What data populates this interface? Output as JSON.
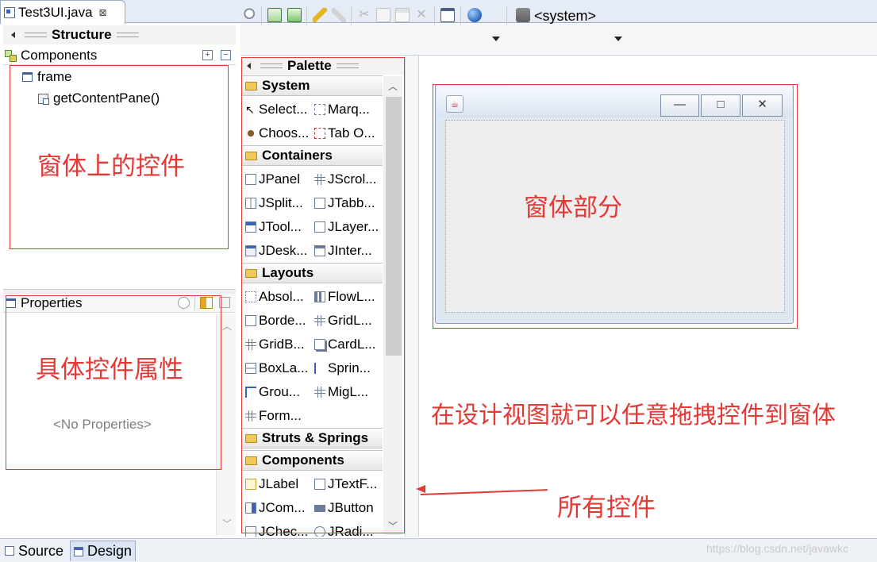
{
  "editor": {
    "tab_title": "Test3UI.java",
    "close_glyph": "⊠"
  },
  "structure": {
    "header": "Structure",
    "components_label": "Components",
    "expand_glyph": "+",
    "collapse_glyph": "−",
    "tree": [
      {
        "label": "frame"
      },
      {
        "label": "getContentPane()"
      }
    ]
  },
  "properties": {
    "header": "Properties",
    "empty_text": "<No Properties>"
  },
  "toolbar": {
    "system_label": "<system>"
  },
  "palette": {
    "header": "Palette",
    "categories": {
      "system": "System",
      "containers": "Containers",
      "layouts": "Layouts",
      "struts": "Struts & Springs",
      "components": "Components"
    },
    "items": {
      "system": [
        "Select...",
        "Marq...",
        "Choos...",
        "Tab O..."
      ],
      "containers": [
        "JPanel",
        "JScrol...",
        "JSplit...",
        "JTabb...",
        "JTool...",
        "JLayer...",
        "JDesk...",
        "JInter..."
      ],
      "layouts": [
        "Absol...",
        "FlowL...",
        "Borde...",
        "GridL...",
        "GridB...",
        "CardL...",
        "BoxLa...",
        "Sprin...",
        "Grou...",
        "MigL...",
        "Form..."
      ],
      "components": [
        "JLabel",
        "JTextF...",
        "JCom...",
        "JButton",
        "JChec...",
        "JRadi..."
      ]
    }
  },
  "frame_buttons": {
    "minimize": "—",
    "maximize": "□",
    "close": "✕"
  },
  "bottom_tabs": {
    "source": "Source",
    "design": "Design"
  },
  "watermark": "https://blog.csdn.net/javawkc",
  "annotations": {
    "controls_on_window": "窗体上的控件",
    "control_properties": "具体控件属性",
    "window_part": "窗体部分",
    "drag_hint": "在设计视图就可以任意拖拽控件到窗体",
    "all_controls": "所有控件"
  },
  "colors": {
    "annotation_red": "#e53935",
    "accent_blue": "#3a64b7"
  }
}
